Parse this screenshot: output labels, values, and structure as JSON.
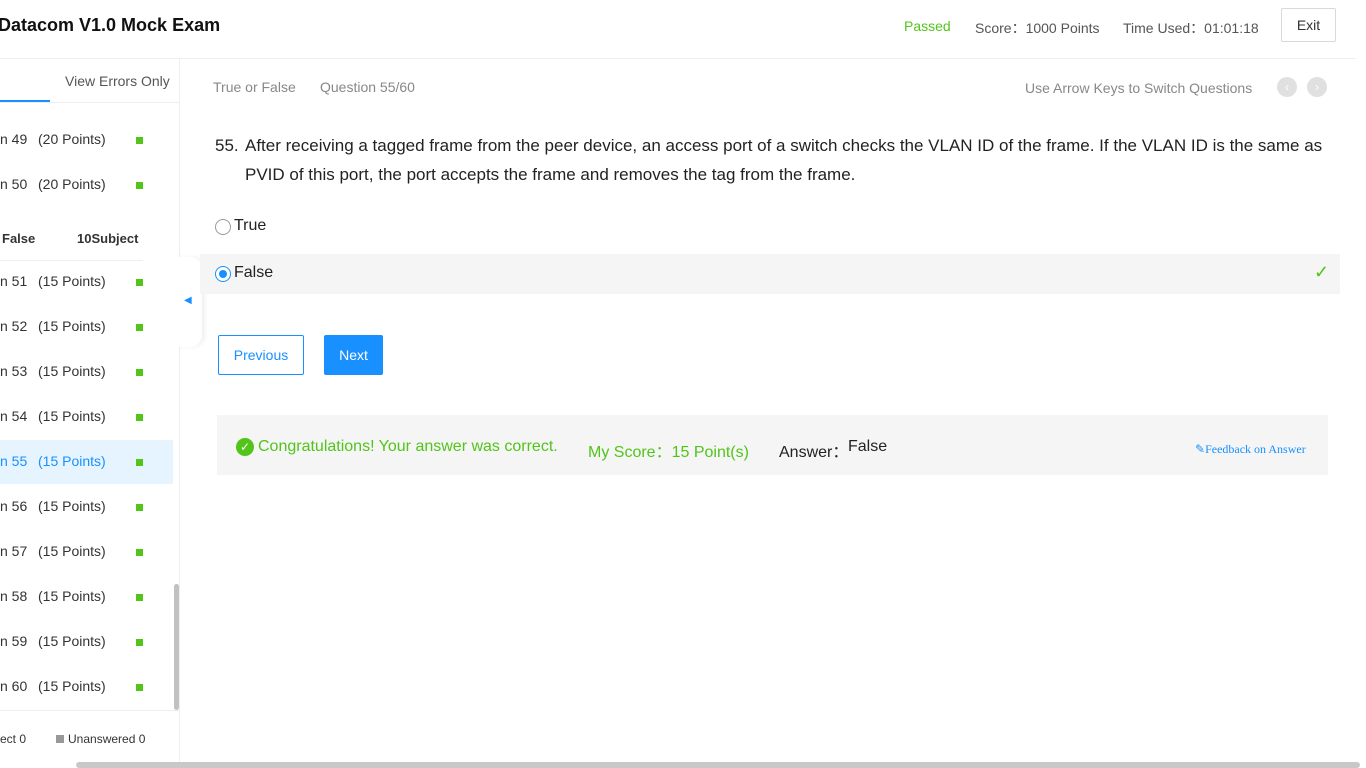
{
  "header": {
    "title": "Datacom V1.0 Mock Exam",
    "status": "Passed",
    "score": "Score：1000 Points",
    "time": "Time Used：01:01:18",
    "exit_label": "Exit"
  },
  "sidebar": {
    "tab_errors": "View Errors Only",
    "questions_top": [
      {
        "label": "n 49",
        "points": "(20 Points)"
      },
      {
        "label": "n 50",
        "points": "(20 Points)"
      }
    ],
    "section": {
      "name": "False",
      "count": "10Subject"
    },
    "questions": [
      {
        "label": "n 51",
        "points": "(15 Points)"
      },
      {
        "label": "n 52",
        "points": "(15 Points)"
      },
      {
        "label": "n 53",
        "points": "(15 Points)"
      },
      {
        "label": "n 54",
        "points": "(15 Points)"
      },
      {
        "label": "n 55",
        "points": "(15 Points)"
      },
      {
        "label": "n 56",
        "points": "(15 Points)"
      },
      {
        "label": "n 57",
        "points": "(15 Points)"
      },
      {
        "label": "n 58",
        "points": "(15 Points)"
      },
      {
        "label": "n 59",
        "points": "(15 Points)"
      },
      {
        "label": "n 60",
        "points": "(15 Points)"
      }
    ],
    "active_question": "n 55",
    "legend_correct": "ect 0",
    "legend_unanswered": "Unanswered 0",
    "status_color": "#52c41a"
  },
  "question": {
    "type": "True or False",
    "number": "Question 55/60",
    "arrow_hint": "Use Arrow Keys to Switch Questions",
    "index": "55.",
    "text": "After receiving a tagged frame from the peer device, an access port of a switch checks the VLAN ID of the frame. If the VLAN ID is the same as PVID of this port, the port accepts the frame and removes the tag from the frame.",
    "options": [
      {
        "label": "True",
        "selected": false
      },
      {
        "label": "False",
        "selected": true
      }
    ]
  },
  "buttons": {
    "previous": "Previous",
    "next": "Next"
  },
  "result": {
    "message": "Congratulations! Your answer was correct.",
    "my_score": "My Score：15 Point(s)",
    "answer_label": "Answer：",
    "answer_value": "False",
    "feedback": "Feedback on Answer"
  },
  "colors": {
    "accent": "#1890ff",
    "success": "#52c41a"
  }
}
